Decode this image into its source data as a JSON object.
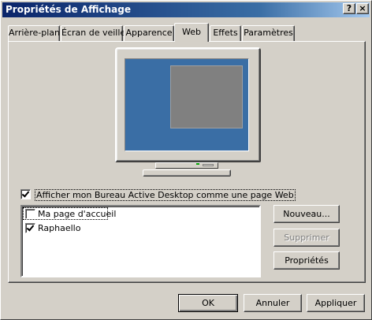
{
  "window": {
    "title": "Propriétés de Affichage",
    "help_glyph": "?",
    "close_glyph": "×"
  },
  "tabs": [
    {
      "label": "Arrière-plan"
    },
    {
      "label": "Écran de veille"
    },
    {
      "label": "Apparence"
    },
    {
      "label": "Web"
    },
    {
      "label": "Effets"
    },
    {
      "label": "Paramètres"
    }
  ],
  "active_tab": "Web",
  "web": {
    "active_desktop_checkbox": {
      "label": "Afficher mon Bureau Active Desktop comme une page Web",
      "checked": true
    },
    "items": [
      {
        "label": "Ma page d'accueil",
        "checked": false
      },
      {
        "label": "Raphaello",
        "checked": true
      }
    ],
    "buttons": {
      "new": "Nouveau...",
      "delete": "Supprimer",
      "properties": "Propriétés"
    }
  },
  "footer": {
    "ok": "OK",
    "cancel": "Annuler",
    "apply": "Appliquer"
  },
  "colors": {
    "face": "#d4d0c8",
    "title_start": "#0a246a",
    "title_end": "#a6caf0",
    "desktop": "#3a6ea5",
    "preview_window": "#808080"
  }
}
